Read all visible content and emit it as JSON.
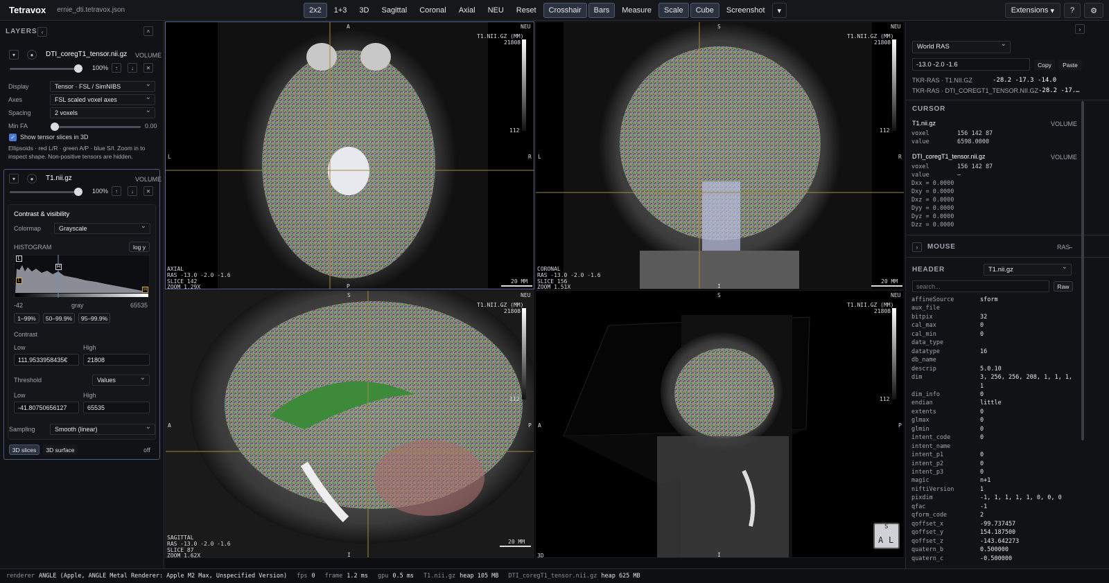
{
  "app": {
    "title": "Tetravox",
    "file": "ernie_dti.tetravox.json"
  },
  "toolbar": {
    "items": [
      "2x2",
      "1+3",
      "3D",
      "Sagittal",
      "Coronal",
      "Axial",
      "NEU",
      "Reset",
      "Crosshair",
      "Bars",
      "Measure",
      "Scale",
      "Cube",
      "Screenshot"
    ],
    "more_icon": "chevron-down-icon"
  },
  "topright": {
    "extensions": "Extensions",
    "help": "?",
    "settings": "⚙"
  },
  "layers": {
    "title": "LAYERS",
    "dti": {
      "name": "DTI_coregT1_tensor.nii.gz",
      "type": "VOLUME",
      "opacity": "100%",
      "display_label": "Display",
      "display_value": "Tensor · FSL / SimNIBS",
      "axes_label": "Axes",
      "axes_value": "FSL scaled voxel axes",
      "spacing_label": "Spacing",
      "spacing_value": "2 voxels",
      "minfa_label": "Min FA",
      "minfa_value": "0.00",
      "show3d_label": "Show tensor slices in 3D",
      "note": "Ellipsoids · red L/R · green A/P · blue S/I. Zoom in to inspect shape. Non-positive tensors are hidden."
    },
    "t1": {
      "name": "T1.nii.gz",
      "type": "VOLUME",
      "opacity": "100%",
      "section": "Contrast & visibility",
      "colormap_label": "Colormap",
      "colormap_value": "Grayscale",
      "histogram_label": "HISTOGRAM",
      "logy": "log y",
      "hist_min": "-42",
      "hist_mid": "gray",
      "hist_max": "65535",
      "presets": [
        "1–99%",
        "50–99.9%",
        "95–99.9%"
      ],
      "contrast_label": "Contrast",
      "low_label": "Low",
      "high_label": "High",
      "contrast_low": "111.9533958435€",
      "contrast_high": "21808",
      "threshold_label": "Threshold",
      "threshold_mode": "Values",
      "thr_low": "-41.80750656127",
      "thr_high": "65535",
      "sampling_label": "Sampling",
      "sampling_value": "Smooth (linear)",
      "btn_slices": "3D slices",
      "btn_surface": "3D surface",
      "off": "off"
    }
  },
  "views": {
    "axial": {
      "top": "A",
      "bottom": "P",
      "left": "L",
      "right": "R",
      "neu": "NEU",
      "unit": "T1.NII.GZ (MM)",
      "cmax": "21808",
      "cmin": "112",
      "name": "AXIAL",
      "ras": "RAS -13.0 -2.0 -1.6",
      "slice": "SLICE 142",
      "zoom": "ZOOM 1.29X",
      "scale": "20 MM"
    },
    "coronal": {
      "top": "S",
      "bottom": "I",
      "left": "L",
      "right": "R",
      "neu": "NEU",
      "unit": "T1.NII.GZ (MM)",
      "cmax": "21808",
      "cmin": "112",
      "name": "CORONAL",
      "ras": "RAS -13.0 -2.0 -1.6",
      "slice": "SLICE 156",
      "zoom": "ZOOM 1.51X",
      "scale": "20 MM"
    },
    "sagittal": {
      "top": "S",
      "bottom": "I",
      "left": "A",
      "right": "P",
      "neu": "NEU",
      "unit": "T1.NII.GZ (MM)",
      "cmax": "21808",
      "cmin": "112",
      "name": "SAGITTAL",
      "ras": "RAS -13.0 -2.0 -1.6",
      "slice": "SLICE 87",
      "zoom": "ZOOM 1.62X",
      "scale": "20 MM"
    },
    "threed": {
      "top": "S",
      "bottom": "I",
      "left": "A",
      "right": "P",
      "neu": "NEU",
      "unit": "T1.NII.GZ (MM)",
      "cmax": "21808",
      "cmin": "112",
      "name": "3D",
      "cube_top": "S",
      "cube_a": "A",
      "cube_l": "L"
    }
  },
  "right": {
    "coord_system": "World RAS",
    "coords": "-13.0 -2.0 -1.6",
    "copy": "Copy",
    "paste": "Paste",
    "tkr1_label": "TKR-RAS · T1.NII.GZ",
    "tkr1_value": "-28.2 -17.3 -14.0",
    "tkr2_label": "TKR-RAS · DTI_COREGT1_TENSOR.NII.GZ",
    "tkr2_value": "-28.2 -17.…",
    "cursor_title": "CURSOR",
    "c1_name": "T1.nii.gz",
    "c1_type": "VOLUME",
    "c1_voxel_label": "voxel",
    "c1_voxel": "156 142 87",
    "c1_value_label": "value",
    "c1_value": "6598.0000",
    "c2_name": "DTI_coregT1_tensor.nii.gz",
    "c2_type": "VOLUME",
    "c2_voxel_label": "voxel",
    "c2_voxel": "156 142 87",
    "c2_value_label": "value",
    "c2_value": "–",
    "tensor": [
      "Dxx = 0.0000",
      "Dxy = 0.0000",
      "Dxz = 0.0000",
      "Dyy = 0.0000",
      "Dyz = 0.0000",
      "Dzz = 0.0000"
    ],
    "mouse_title": "MOUSE",
    "mouse_ras": "RAS",
    "mouse_dash": "–",
    "header_title": "HEADER",
    "header_file": "T1.nii.gz",
    "search_placeholder": "search...",
    "raw": "Raw",
    "header_rows": [
      [
        "affineSource",
        "sform"
      ],
      [
        "aux_file",
        ""
      ],
      [
        "bitpix",
        "32"
      ],
      [
        "cal_max",
        "0"
      ],
      [
        "cal_min",
        "0"
      ],
      [
        "data_type",
        ""
      ],
      [
        "datatype",
        "16"
      ],
      [
        "db_name",
        ""
      ],
      [
        "descrip",
        "5.0.10"
      ],
      [
        "dim",
        "3, 256, 256, 208, 1, 1, 1,"
      ],
      [
        "",
        "1"
      ],
      [
        "dim_info",
        "0"
      ],
      [
        "endian",
        "little"
      ],
      [
        "extents",
        "0"
      ],
      [
        "glmax",
        "0"
      ],
      [
        "glmin",
        "0"
      ],
      [
        "intent_code",
        "0"
      ],
      [
        "intent_name",
        ""
      ],
      [
        "intent_p1",
        "0"
      ],
      [
        "intent_p2",
        "0"
      ],
      [
        "intent_p3",
        "0"
      ],
      [
        "magic",
        "n+1"
      ],
      [
        "niftiVersion",
        "1"
      ],
      [
        "pixdim",
        "-1, 1, 1, 1, 1, 0, 0, 0"
      ],
      [
        "qfac",
        "-1"
      ],
      [
        "qform_code",
        "2"
      ],
      [
        "qoffset_x",
        "-99.737457"
      ],
      [
        "qoffset_y",
        "154.187500"
      ],
      [
        "qoffset_z",
        "-143.642273"
      ],
      [
        "quatern_b",
        "0.500000"
      ],
      [
        "quatern_c",
        "-0.500000"
      ]
    ]
  },
  "status": {
    "renderer_label": "renderer",
    "renderer": "ANGLE (Apple, ANGLE Metal Renderer: Apple M2 Max, Unspecified Version)",
    "fps_label": "fps",
    "fps": "0",
    "frame_label": "frame",
    "frame": "1.2 ms",
    "gpu_label": "gpu",
    "gpu": "0.5 ms",
    "heap1_file": "T1.nii.gz",
    "heap1": "heap 105 MB",
    "heap2_file": "DTI_coregT1_tensor.nii.gz",
    "heap2": "heap 625 MB"
  }
}
